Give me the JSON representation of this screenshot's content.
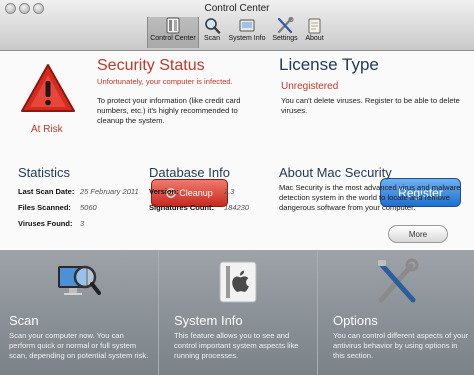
{
  "window": {
    "title": "Control Center"
  },
  "toolbar": {
    "items": [
      {
        "label": "Control Center",
        "icon": "control-center-icon",
        "active": true
      },
      {
        "label": "Scan",
        "icon": "magnifier-icon"
      },
      {
        "label": "System Info",
        "icon": "system-info-icon"
      },
      {
        "label": "Settings",
        "icon": "tools-icon"
      },
      {
        "label": "About",
        "icon": "about-icon"
      }
    ]
  },
  "security_status": {
    "heading": "Security Status",
    "subtitle": "Unfortunately, your computer is infected.",
    "message": "To protect your information (like credit card numbers, etc.) it's highly recommended to cleanup the system.",
    "state_label": "At Risk",
    "cleanup_button": "Cleanup"
  },
  "statistics": {
    "heading": "Statistics",
    "rows": [
      {
        "label": "Last Scan Date:",
        "value": "25 February 2011"
      },
      {
        "label": "Files Scanned:",
        "value": "5060"
      },
      {
        "label": "Viruses Found:",
        "value": "3"
      }
    ]
  },
  "database_info": {
    "heading": "Database Info",
    "rows": [
      {
        "label": "Version:",
        "value": "2.3"
      },
      {
        "label": "Signatures Count:",
        "value": "184230"
      }
    ]
  },
  "license": {
    "heading": "License Type",
    "status": "Unregistered",
    "message": "You can't delete viruses. Register to be able to delete viruses.",
    "register_button": "Register"
  },
  "about": {
    "heading": "About Mac Security",
    "text": "Mac Security is the most advanced virus and malware detection system in the world to locate and remove dangerous software from your computer.",
    "more_button": "More"
  },
  "tiles": [
    {
      "title": "Scan",
      "text": "Scan your computer now. You can perform quick or normal or full system scan, depending on potential system risk."
    },
    {
      "title": "System Info",
      "text": "This feature allows you to see and control important system aspects like running processes."
    },
    {
      "title": "Options",
      "text": "You can control different aspects of your antivirus behavior by using options in this section."
    }
  ],
  "colors": {
    "alert_red": "#c0392b",
    "heading_blue": "#1f3a5a",
    "register_blue": "#1f6fcf"
  }
}
